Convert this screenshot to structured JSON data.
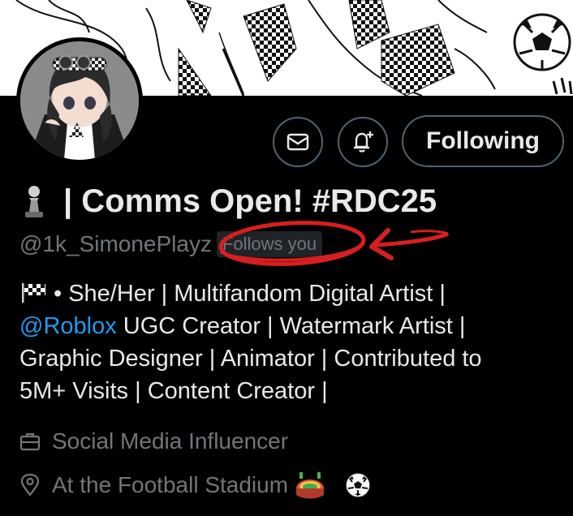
{
  "header": {
    "follow_button_label": "Following"
  },
  "profile": {
    "display_name": "| Comms Open! #RDC25",
    "handle": "@1k_SimonePlayz",
    "follows_you_badge": "Follows you",
    "bio": {
      "line1": "• She/Her | Multifandom Digital Artist |",
      "mention": "@Roblox",
      "line2_rest": " UGC Creator | Watermark Artist |",
      "line3": "Graphic Designer | Animator | Contributed to",
      "line4": "5M+ Visits | Content Creator |"
    },
    "profession": "Social Media Influencer",
    "location": "At the Football Stadium"
  },
  "colors": {
    "background": "#000000",
    "text_primary": "#e7e9ea",
    "text_secondary": "#71767b",
    "link": "#1d9bf0",
    "annotation_red": "#d81e1e"
  },
  "icons": {
    "message": "envelope-icon",
    "notifications": "bell-plus-icon",
    "profession": "briefcase-icon",
    "location": "location-pin-icon",
    "name_emoji": "chess-pawn-icon",
    "bio_emoji": "checkered-flag-icon",
    "location_emojis": [
      "stadium-icon",
      "soccer-ball-icon"
    ]
  }
}
